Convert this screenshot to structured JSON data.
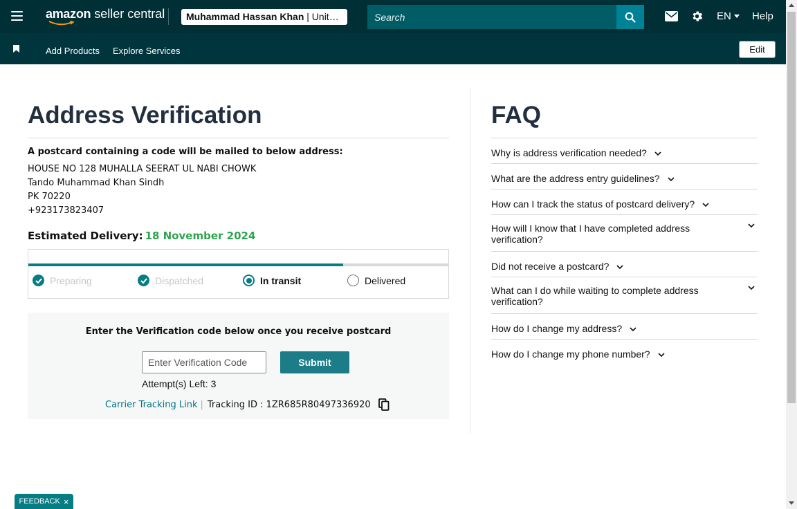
{
  "header": {
    "brand": "amazon",
    "product": "seller central",
    "account_name": "Muhammad Hassan Khan",
    "account_region": "Unit…",
    "search_placeholder": "Search",
    "language": "EN",
    "help": "Help"
  },
  "nav": {
    "add_products": "Add Products",
    "explore_services": "Explore Services",
    "edit": "Edit"
  },
  "main": {
    "title": "Address Verification",
    "intro": "A postcard containing a code will be mailed to below address:",
    "address": [
      "HOUSE NO 128 MUHALLA SEERAT UL NABI CHOWK",
      "Tando Muhammad Khan Sindh",
      "PK 70220",
      "+923173823407"
    ],
    "estimated_label": "Estimated Delivery:",
    "estimated_date": "18 November 2024",
    "tracker": {
      "progress": 0.75,
      "steps": [
        {
          "label": "Preparing",
          "state": "done"
        },
        {
          "label": "Dispatched",
          "state": "done"
        },
        {
          "label": "In transit",
          "state": "current"
        },
        {
          "label": "Delivered",
          "state": "pending"
        }
      ]
    },
    "verify": {
      "heading": "Enter the Verification code below once you receive postcard",
      "input_placeholder": "Enter Verification Code",
      "submit": "Submit",
      "attempts": "Attempt(s) Left: 3",
      "carrier_link": "Carrier Tracking Link",
      "separator": "|",
      "tracking_id": "Tracking ID : 1ZR685R80497336920"
    }
  },
  "faq": {
    "title": "FAQ",
    "items": [
      "Why is address verification needed?",
      "What are the address entry guidelines?",
      "How can I track the status of postcard delivery?",
      "How will I know that I have completed address verification?",
      "Did not receive a postcard?",
      "What can I do while waiting to complete address verification?",
      "How do I change my address?",
      "How do I change my phone number?"
    ]
  },
  "feedback": {
    "label": "FEEDBACK",
    "close": "×"
  },
  "colors": {
    "header_bg": "#002f36",
    "nav_bg": "#00353d",
    "accent": "#067d83",
    "date_green": "#2ea44f",
    "link": "#007185"
  }
}
